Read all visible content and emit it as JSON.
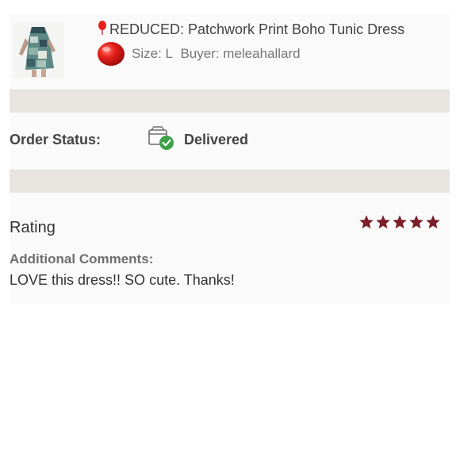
{
  "item": {
    "title": "REDUCED: Patchwork Print Boho Tunic Dress",
    "size_label": "Size: L",
    "buyer_label": "Buyer: meleahallard",
    "thumbnail_icon": "dress-thumbnail-image"
  },
  "order": {
    "status_label": "Order Status:",
    "status_value": "Delivered",
    "status_icon": "delivered-box-check-icon"
  },
  "review": {
    "rating_label": "Rating",
    "rating": 5,
    "rating_max": 5,
    "comments_label": "Additional Comments:",
    "comment": "LOVE this dress!! SO cute. Thanks!"
  },
  "colors": {
    "star": "#7a1f2b",
    "check": "#3fa04a",
    "balloon": "#e8201c",
    "separator": "#e8e5e1"
  }
}
